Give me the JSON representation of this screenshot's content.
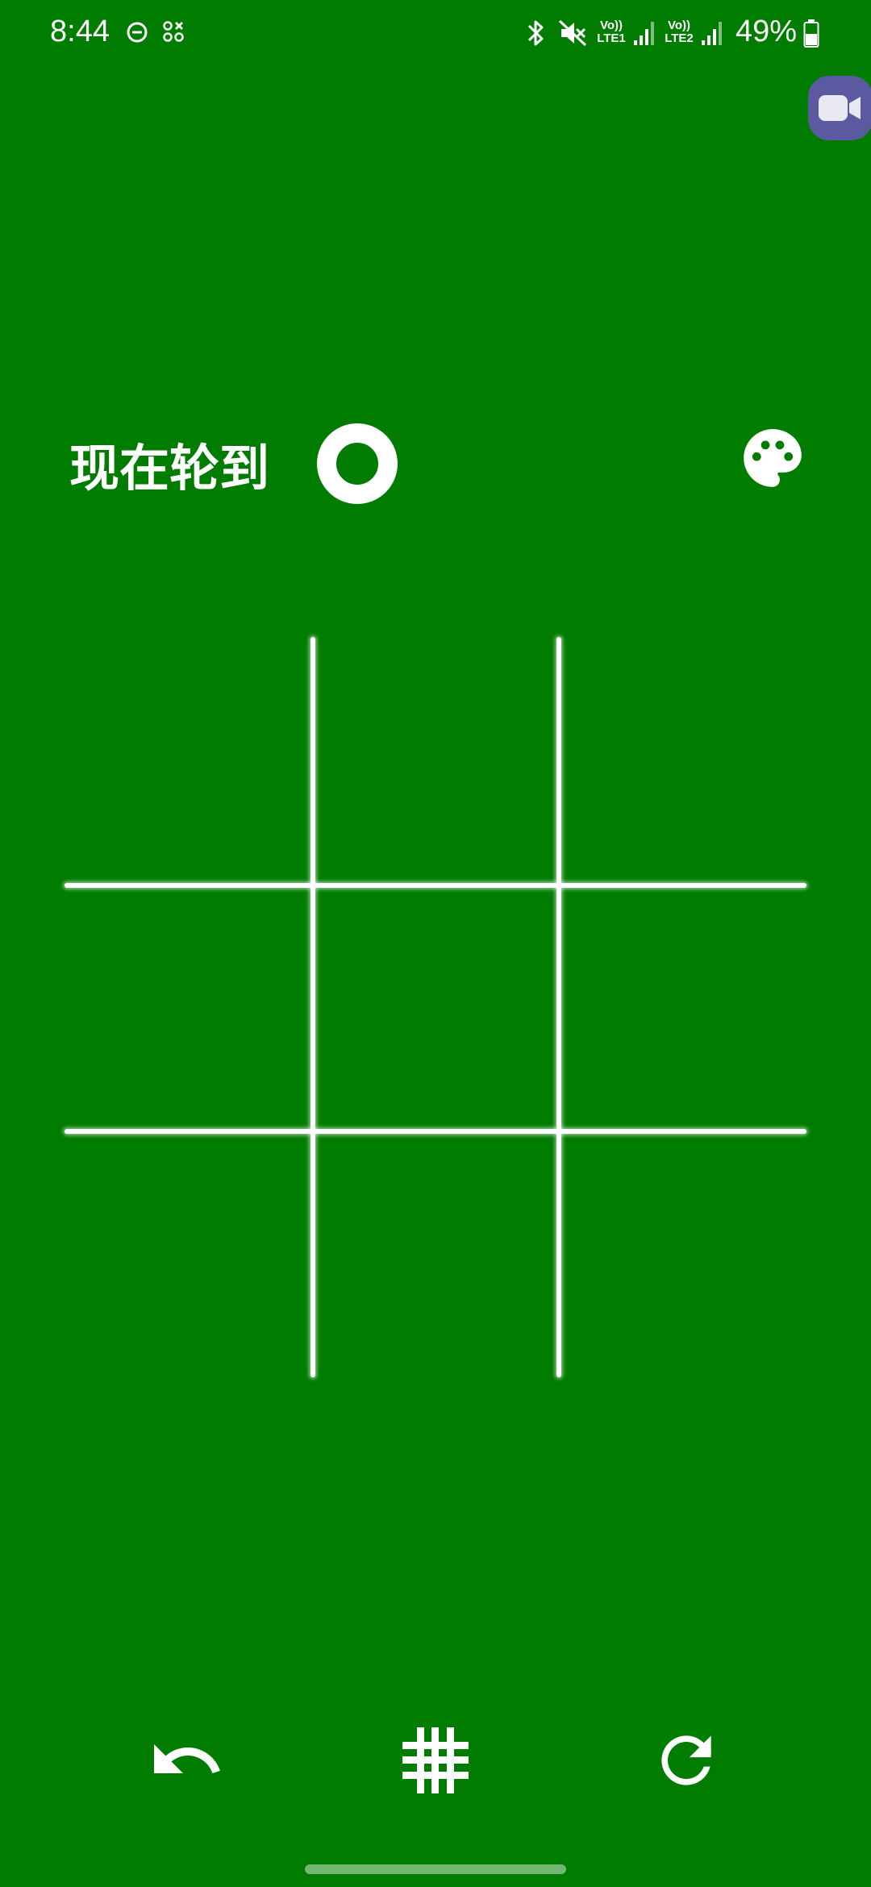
{
  "status_bar": {
    "time": "8:44",
    "volte1": "Vo))\nLTE1",
    "volte1_top": "Vo))",
    "volte1_bottom": "LTE1",
    "volte2_top": "Vo))",
    "volte2_bottom": "LTE2",
    "battery": "49%",
    "icons": [
      "do-not-disturb-icon",
      "app-notification-icon",
      "bluetooth-icon",
      "mute-icon",
      "signal-icon",
      "battery-icon"
    ]
  },
  "floating": {
    "icon": "video-camera-icon",
    "color": "#5b5aa0"
  },
  "game": {
    "turn_label": "现在轮到",
    "current_player": "O",
    "board": [
      [
        "",
        "",
        ""
      ],
      [
        "",
        "",
        ""
      ],
      [
        "",
        "",
        ""
      ]
    ]
  },
  "toolbar": {
    "icons": [
      "undo-icon",
      "grid-icon",
      "restart-icon"
    ]
  },
  "colors": {
    "background": "#007d00",
    "foreground": "#ffffff"
  }
}
